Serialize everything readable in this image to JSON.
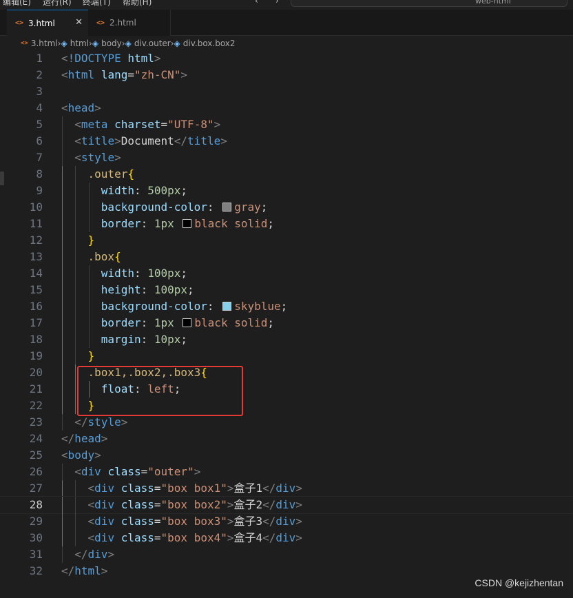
{
  "menubar": {
    "items": [
      "编辑(E)",
      "运行(R)",
      "终端(T)",
      "帮助(H)"
    ],
    "search_text": "web-html"
  },
  "tabs": [
    {
      "label": "3.html",
      "icon": "html-file-icon",
      "active": true
    },
    {
      "label": "2.html",
      "icon": "html-file-icon",
      "active": false
    }
  ],
  "breadcrumb": [
    "3.html",
    "html",
    "body",
    "div.outer",
    "div.box.box2"
  ],
  "editor": {
    "current_line": 28,
    "lines": [
      {
        "n": 1,
        "tokens": [
          [
            "br",
            "<"
          ],
          [
            "kw",
            "!DOCTYPE"
          ],
          [
            "txt",
            " "
          ],
          [
            "attr",
            "html"
          ],
          [
            "br",
            ">"
          ]
        ]
      },
      {
        "n": 2,
        "tokens": [
          [
            "br",
            "<"
          ],
          [
            "tag",
            "html"
          ],
          [
            "txt",
            " "
          ],
          [
            "attr",
            "lang"
          ],
          [
            "txt",
            "="
          ],
          [
            "str",
            "\"zh-CN\""
          ],
          [
            "br",
            ">"
          ]
        ]
      },
      {
        "n": 3,
        "tokens": []
      },
      {
        "n": 4,
        "tokens": [
          [
            "br",
            "<"
          ],
          [
            "tag",
            "head"
          ],
          [
            "br",
            ">"
          ]
        ]
      },
      {
        "n": 5,
        "tokens": [
          [
            "txt",
            "  "
          ],
          [
            "br",
            "<"
          ],
          [
            "tag",
            "meta"
          ],
          [
            "txt",
            " "
          ],
          [
            "attr",
            "charset"
          ],
          [
            "txt",
            "="
          ],
          [
            "str",
            "\"UTF-8\""
          ],
          [
            "br",
            ">"
          ]
        ]
      },
      {
        "n": 6,
        "tokens": [
          [
            "txt",
            "  "
          ],
          [
            "br",
            "<"
          ],
          [
            "tag",
            "title"
          ],
          [
            "br",
            ">"
          ],
          [
            "txt",
            "Document"
          ],
          [
            "br",
            "</"
          ],
          [
            "tag",
            "title"
          ],
          [
            "br",
            ">"
          ]
        ]
      },
      {
        "n": 7,
        "tokens": [
          [
            "txt",
            "  "
          ],
          [
            "br",
            "<"
          ],
          [
            "tag",
            "style"
          ],
          [
            "br",
            ">"
          ]
        ]
      },
      {
        "n": 8,
        "tokens": [
          [
            "txt",
            "    "
          ],
          [
            "sel",
            ".outer"
          ],
          [
            "brace",
            "{"
          ]
        ]
      },
      {
        "n": 9,
        "tokens": [
          [
            "txt",
            "      "
          ],
          [
            "prop",
            "width"
          ],
          [
            "txt",
            ": "
          ],
          [
            "num",
            "500px"
          ],
          [
            "txt",
            ";"
          ]
        ]
      },
      {
        "n": 10,
        "tokens": [
          [
            "txt",
            "      "
          ],
          [
            "prop",
            "background-color"
          ],
          [
            "txt",
            ": "
          ],
          [
            "swatch",
            "#808080"
          ],
          [
            "val",
            "gray"
          ],
          [
            "txt",
            ";"
          ]
        ]
      },
      {
        "n": 11,
        "tokens": [
          [
            "txt",
            "      "
          ],
          [
            "prop",
            "border"
          ],
          [
            "txt",
            ": "
          ],
          [
            "num",
            "1px"
          ],
          [
            "txt",
            " "
          ],
          [
            "swatch",
            "#000000"
          ],
          [
            "val",
            "black"
          ],
          [
            "txt",
            " "
          ],
          [
            "val",
            "solid"
          ],
          [
            "txt",
            ";"
          ]
        ]
      },
      {
        "n": 12,
        "tokens": [
          [
            "txt",
            "    "
          ],
          [
            "brace",
            "}"
          ]
        ]
      },
      {
        "n": 13,
        "tokens": [
          [
            "txt",
            "    "
          ],
          [
            "sel",
            ".box"
          ],
          [
            "brace",
            "{"
          ]
        ]
      },
      {
        "n": 14,
        "tokens": [
          [
            "txt",
            "      "
          ],
          [
            "prop",
            "width"
          ],
          [
            "txt",
            ": "
          ],
          [
            "num",
            "100px"
          ],
          [
            "txt",
            ";"
          ]
        ]
      },
      {
        "n": 15,
        "tokens": [
          [
            "txt",
            "      "
          ],
          [
            "prop",
            "height"
          ],
          [
            "txt",
            ": "
          ],
          [
            "num",
            "100px"
          ],
          [
            "txt",
            ";"
          ]
        ]
      },
      {
        "n": 16,
        "tokens": [
          [
            "txt",
            "      "
          ],
          [
            "prop",
            "background-color"
          ],
          [
            "txt",
            ": "
          ],
          [
            "swatch",
            "#87ceeb"
          ],
          [
            "val",
            "skyblue"
          ],
          [
            "txt",
            ";"
          ]
        ]
      },
      {
        "n": 17,
        "tokens": [
          [
            "txt",
            "      "
          ],
          [
            "prop",
            "border"
          ],
          [
            "txt",
            ": "
          ],
          [
            "num",
            "1px"
          ],
          [
            "txt",
            " "
          ],
          [
            "swatch",
            "#000000"
          ],
          [
            "val",
            "black"
          ],
          [
            "txt",
            " "
          ],
          [
            "val",
            "solid"
          ],
          [
            "txt",
            ";"
          ]
        ]
      },
      {
        "n": 18,
        "tokens": [
          [
            "txt",
            "      "
          ],
          [
            "prop",
            "margin"
          ],
          [
            "txt",
            ": "
          ],
          [
            "num",
            "10px"
          ],
          [
            "txt",
            ";"
          ]
        ]
      },
      {
        "n": 19,
        "tokens": [
          [
            "txt",
            "    "
          ],
          [
            "brace",
            "}"
          ]
        ]
      },
      {
        "n": 20,
        "tokens": [
          [
            "txt",
            "    "
          ],
          [
            "sel",
            ".box1,.box2,.box3"
          ],
          [
            "brace",
            "{"
          ]
        ]
      },
      {
        "n": 21,
        "tokens": [
          [
            "txt",
            "      "
          ],
          [
            "prop",
            "float"
          ],
          [
            "txt",
            ": "
          ],
          [
            "val",
            "left"
          ],
          [
            "txt",
            ";"
          ]
        ]
      },
      {
        "n": 22,
        "tokens": [
          [
            "txt",
            "    "
          ],
          [
            "brace",
            "}"
          ]
        ]
      },
      {
        "n": 23,
        "tokens": [
          [
            "txt",
            "  "
          ],
          [
            "br",
            "</"
          ],
          [
            "tag",
            "style"
          ],
          [
            "br",
            ">"
          ]
        ]
      },
      {
        "n": 24,
        "tokens": [
          [
            "br",
            "</"
          ],
          [
            "tag",
            "head"
          ],
          [
            "br",
            ">"
          ]
        ]
      },
      {
        "n": 25,
        "tokens": [
          [
            "br",
            "<"
          ],
          [
            "tag",
            "body"
          ],
          [
            "br",
            ">"
          ]
        ]
      },
      {
        "n": 26,
        "tokens": [
          [
            "txt",
            "  "
          ],
          [
            "br",
            "<"
          ],
          [
            "tag",
            "div"
          ],
          [
            "txt",
            " "
          ],
          [
            "attr",
            "class"
          ],
          [
            "txt",
            "="
          ],
          [
            "str",
            "\"outer\""
          ],
          [
            "br",
            ">"
          ]
        ]
      },
      {
        "n": 27,
        "tokens": [
          [
            "txt",
            "    "
          ],
          [
            "br",
            "<"
          ],
          [
            "tag",
            "div"
          ],
          [
            "txt",
            " "
          ],
          [
            "attr",
            "class"
          ],
          [
            "txt",
            "="
          ],
          [
            "str",
            "\"box box1\""
          ],
          [
            "br",
            ">"
          ],
          [
            "txt",
            "盒子1"
          ],
          [
            "br",
            "</"
          ],
          [
            "tag",
            "div"
          ],
          [
            "br",
            ">"
          ]
        ]
      },
      {
        "n": 28,
        "tokens": [
          [
            "txt",
            "    "
          ],
          [
            "br",
            "<"
          ],
          [
            "tag",
            "div"
          ],
          [
            "txt",
            " "
          ],
          [
            "attr",
            "class"
          ],
          [
            "txt",
            "="
          ],
          [
            "str",
            "\"box box2\""
          ],
          [
            "br",
            ">"
          ],
          [
            "txt",
            "盒子2"
          ],
          [
            "br",
            "</"
          ],
          [
            "tag",
            "div"
          ],
          [
            "br",
            ">"
          ]
        ]
      },
      {
        "n": 29,
        "tokens": [
          [
            "txt",
            "    "
          ],
          [
            "br",
            "<"
          ],
          [
            "tag",
            "div"
          ],
          [
            "txt",
            " "
          ],
          [
            "attr",
            "class"
          ],
          [
            "txt",
            "="
          ],
          [
            "str",
            "\"box box3\""
          ],
          [
            "br",
            ">"
          ],
          [
            "txt",
            "盒子3"
          ],
          [
            "br",
            "</"
          ],
          [
            "tag",
            "div"
          ],
          [
            "br",
            ">"
          ]
        ]
      },
      {
        "n": 30,
        "tokens": [
          [
            "txt",
            "    "
          ],
          [
            "br",
            "<"
          ],
          [
            "tag",
            "div"
          ],
          [
            "txt",
            " "
          ],
          [
            "attr",
            "class"
          ],
          [
            "txt",
            "="
          ],
          [
            "str",
            "\"box box4\""
          ],
          [
            "br",
            ">"
          ],
          [
            "txt",
            "盒子4"
          ],
          [
            "br",
            "</"
          ],
          [
            "tag",
            "div"
          ],
          [
            "br",
            ">"
          ]
        ]
      },
      {
        "n": 31,
        "tokens": [
          [
            "txt",
            "  "
          ],
          [
            "br",
            "</"
          ],
          [
            "tag",
            "div"
          ],
          [
            "br",
            ">"
          ]
        ]
      },
      {
        "n": 32,
        "tokens": [
          [
            "br",
            "</"
          ],
          [
            "tag",
            "html"
          ],
          [
            "br",
            ">"
          ]
        ]
      }
    ]
  },
  "watermark": "CSDN @kejizhentan",
  "colors": {
    "highlight_box": "#e53935",
    "tab_accent": "#0078d4",
    "editor_bg": "#1e1e1e"
  }
}
